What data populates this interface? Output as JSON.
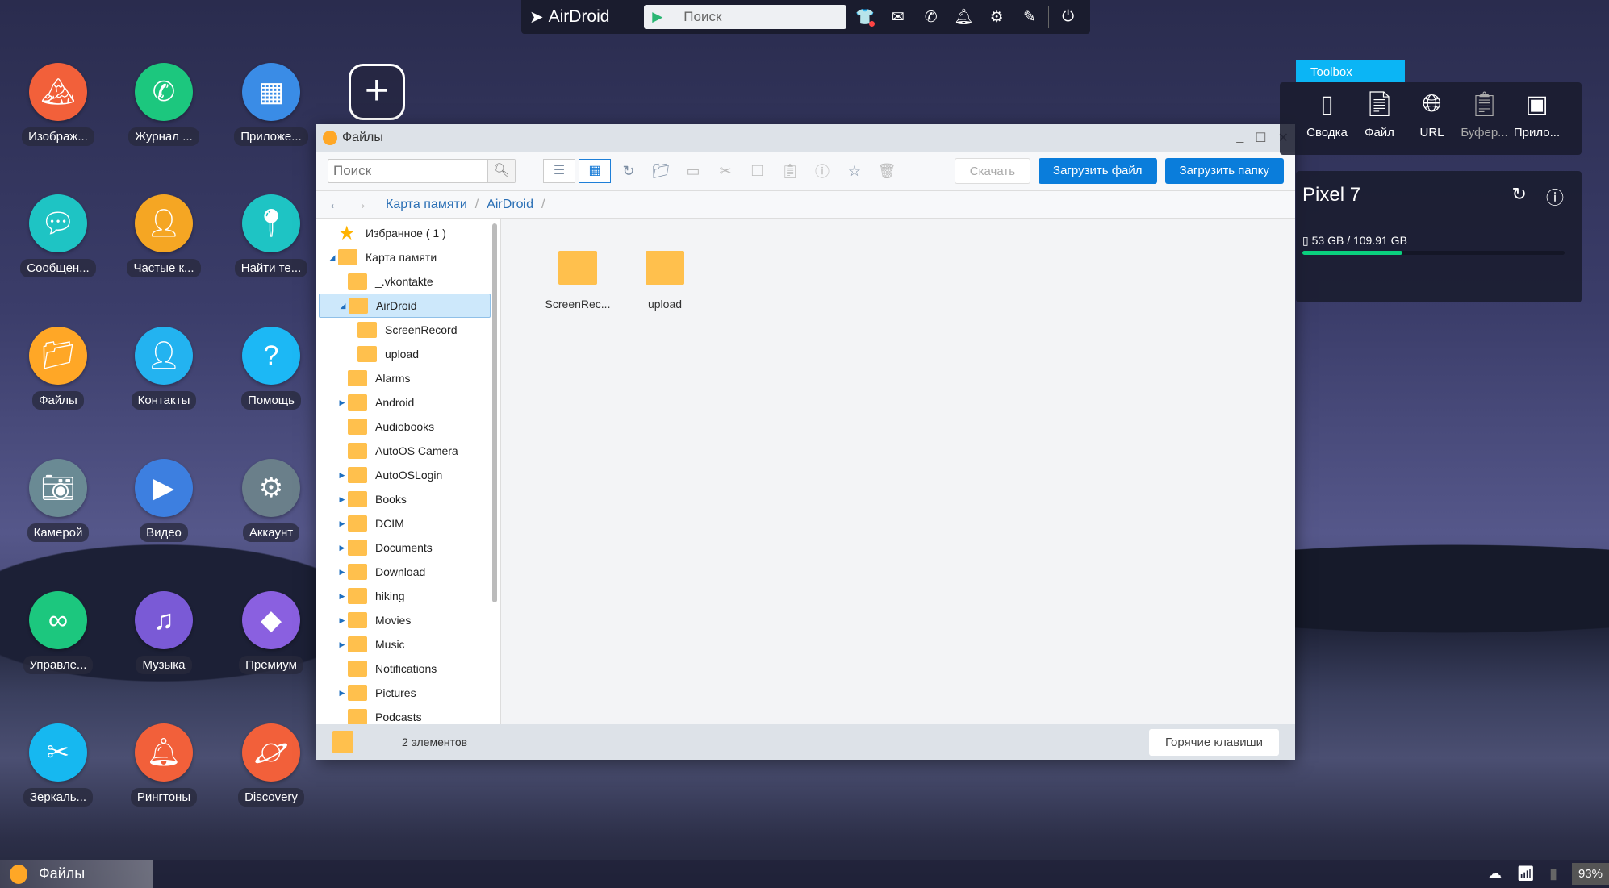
{
  "topbar": {
    "brand": "AirDroid",
    "search_placeholder": "Поиск",
    "icons": [
      "tshirt-icon",
      "mail-add-icon",
      "phone-icon",
      "bell-icon",
      "gear-icon",
      "pen-icon",
      "power-icon"
    ]
  },
  "desktop": {
    "icons": [
      {
        "label": "Изображ...",
        "icon": "image-icon",
        "color": "#f2603a"
      },
      {
        "label": "Журнал ...",
        "icon": "phone-icon",
        "color": "#1cc77e"
      },
      {
        "label": "Приложе...",
        "icon": "apps-icon",
        "color": "#3a8ce6"
      },
      {
        "label": "Сообщен...",
        "icon": "message-icon",
        "color": "#1ec4c4"
      },
      {
        "label": "Частые к...",
        "icon": "frequent-contacts-icon",
        "color": "#f5a623"
      },
      {
        "label": "Найти те...",
        "icon": "location-icon",
        "color": "#1ec4c4"
      },
      {
        "label": "Файлы",
        "icon": "folder-icon",
        "color": "#ffa726"
      },
      {
        "label": "Контакты",
        "icon": "contacts-icon",
        "color": "#23b3f0"
      },
      {
        "label": "Помощь",
        "icon": "help-icon",
        "color": "#1cb8f5"
      },
      {
        "label": "Камерой",
        "icon": "camera-icon",
        "color": "#6a8a94"
      },
      {
        "label": "Видео",
        "icon": "video-icon",
        "color": "#3d7fe0"
      },
      {
        "label": "Аккаунт",
        "icon": "gear-icon",
        "color": "#6a7f8a"
      },
      {
        "label": "Управле...",
        "icon": "binoculars-icon",
        "color": "#1cc77e"
      },
      {
        "label": "Музыка",
        "icon": "music-icon",
        "color": "#7a5ad6"
      },
      {
        "label": "Премиум",
        "icon": "diamond-icon",
        "color": "#8a60e0"
      },
      {
        "label": "Зеркаль...",
        "icon": "scissors-icon",
        "color": "#16b8f0"
      },
      {
        "label": "Рингтоны",
        "icon": "bell-icon",
        "color": "#f2603a"
      },
      {
        "label": "Discovery",
        "icon": "planet-icon",
        "color": "#f2603a"
      }
    ]
  },
  "window": {
    "title": "Файлы",
    "toolbar": {
      "search_placeholder": "Поиск",
      "download": "Скачать",
      "upload_file": "Загрузить файл",
      "upload_folder": "Загрузить папку"
    },
    "breadcrumb": [
      "Карта памяти",
      "AirDroid"
    ],
    "tree": [
      {
        "label": "Избранное ( 1 )",
        "level": 0,
        "type": "star"
      },
      {
        "label": "Карта памяти",
        "level": 0,
        "expanded": true
      },
      {
        "label": "_.vkontakte",
        "level": 1
      },
      {
        "label": "AirDroid",
        "level": 1,
        "expanded": true,
        "selected": true
      },
      {
        "label": "ScreenRecord",
        "level": 2
      },
      {
        "label": "upload",
        "level": 2
      },
      {
        "label": "Alarms",
        "level": 1
      },
      {
        "label": "Android",
        "level": 1,
        "collapsed": true
      },
      {
        "label": "Audiobooks",
        "level": 1
      },
      {
        "label": "AutoOS Camera",
        "level": 1
      },
      {
        "label": "AutoOSLogin",
        "level": 1,
        "collapsed": true
      },
      {
        "label": "Books",
        "level": 1,
        "collapsed": true
      },
      {
        "label": "DCIM",
        "level": 1,
        "collapsed": true
      },
      {
        "label": "Documents",
        "level": 1,
        "collapsed": true
      },
      {
        "label": "Download",
        "level": 1,
        "collapsed": true
      },
      {
        "label": "hiking",
        "level": 1,
        "collapsed": true
      },
      {
        "label": "Movies",
        "level": 1,
        "collapsed": true
      },
      {
        "label": "Music",
        "level": 1,
        "collapsed": true
      },
      {
        "label": "Notifications",
        "level": 1
      },
      {
        "label": "Pictures",
        "level": 1,
        "collapsed": true
      },
      {
        "label": "Podcasts",
        "level": 1
      }
    ],
    "items": [
      "ScreenRec...",
      "upload"
    ],
    "status": "2 элементов",
    "hotkeys": "Горячие клавиши"
  },
  "toolbox": {
    "tab": "Toolbox",
    "tools": [
      {
        "label": "Сводка",
        "icon": "phone-icon"
      },
      {
        "label": "Файл",
        "icon": "file-icon"
      },
      {
        "label": "URL",
        "icon": "globe-link-icon"
      },
      {
        "label": "Буфер...",
        "icon": "clipboard-icon"
      },
      {
        "label": "Прило...",
        "icon": "package-icon"
      }
    ]
  },
  "device": {
    "name": "Pixel 7",
    "storage": "53 GB / 109.91 GB",
    "storage_fill": 0.38,
    "accent": "#0ad07e"
  },
  "taskbar": {
    "app": "Файлы",
    "battery": "93%"
  }
}
